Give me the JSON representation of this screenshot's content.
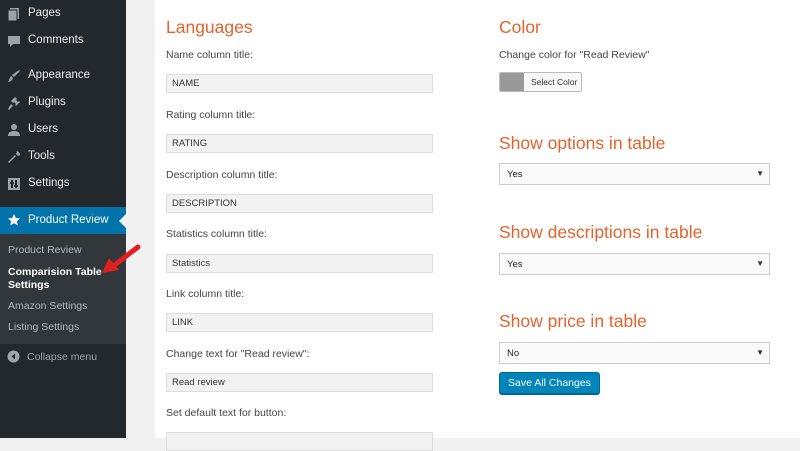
{
  "sidebar": {
    "items": [
      {
        "label": "Pages",
        "icon": "pages-icon"
      },
      {
        "label": "Comments",
        "icon": "comments-icon"
      },
      {
        "label": "Appearance",
        "icon": "appearance-icon"
      },
      {
        "label": "Plugins",
        "icon": "plugins-icon"
      },
      {
        "label": "Users",
        "icon": "users-icon"
      },
      {
        "label": "Tools",
        "icon": "tools-icon"
      },
      {
        "label": "Settings",
        "icon": "settings-icon"
      }
    ],
    "active": {
      "label": "Product Review",
      "icon": "star-icon"
    },
    "submenu": [
      {
        "label": "Product Review"
      },
      {
        "label": "Comparision Table Settings",
        "current": true
      },
      {
        "label": "Amazon Settings"
      },
      {
        "label": "Listing Settings"
      }
    ],
    "collapse_label": "Collapse menu"
  },
  "colors": {
    "sidebar_bg": "#23282d",
    "active_bg": "#0073aa",
    "heading": "#e4632d",
    "button": "#0085ba",
    "arrow": "#e02020"
  },
  "left": {
    "heading": "Languages",
    "fields": [
      {
        "label": "Name column title:",
        "value": "NAME"
      },
      {
        "label": "Rating column title:",
        "value": "RATING"
      },
      {
        "label": "Description column title:",
        "value": "DESCRIPTION"
      },
      {
        "label": "Statistics column title:",
        "value": "Statistics"
      },
      {
        "label": "Link column title:",
        "value": "LINK"
      },
      {
        "label": "Change text for \"Read review\":",
        "value": "Read review"
      },
      {
        "label": "Set default text for button:",
        "value": ""
      }
    ]
  },
  "right": {
    "color": {
      "heading": "Color",
      "label": "Change color for \"Read Review\"",
      "button_label": "Select Color",
      "swatch": "#999999"
    },
    "options": {
      "heading": "Show options in table",
      "selected": "Yes"
    },
    "descriptions": {
      "heading": "Show descriptions in table",
      "selected": "Yes"
    },
    "price": {
      "heading": "Show price in table",
      "selected": "No"
    },
    "save_label": "Save All Changes"
  }
}
